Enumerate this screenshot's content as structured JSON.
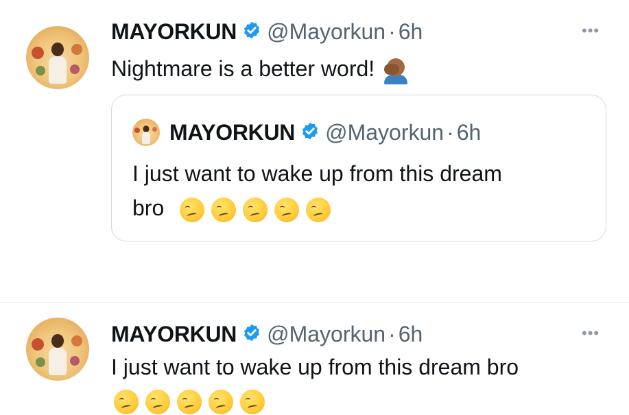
{
  "tweet1": {
    "author": "MAYORKUN",
    "handle": "@Mayorkun",
    "separator": "·",
    "time": "6h",
    "text": "Nightmare is a better word!",
    "text_emoji": "man-facepalming-emoji",
    "more_icon": "more-icon",
    "quoted": {
      "author": "MAYORKUN",
      "handle": "@Mayorkun",
      "separator": "·",
      "time": "6h",
      "line1": "I just want to wake up from this dream",
      "line2": "bro",
      "emoji_count": 5,
      "emoji_name": "woozy-face-emoji"
    }
  },
  "tweet2": {
    "author": "MAYORKUN",
    "handle": "@Mayorkun",
    "separator": "·",
    "time": "6h",
    "text": "I just want to wake up from this dream bro",
    "emoji_count": 5,
    "emoji_name": "woozy-face-emoji",
    "more_icon": "more-icon"
  },
  "colors": {
    "verified": "#1d9bf0",
    "secondary_text": "#536471",
    "border": "#cfd9de"
  }
}
